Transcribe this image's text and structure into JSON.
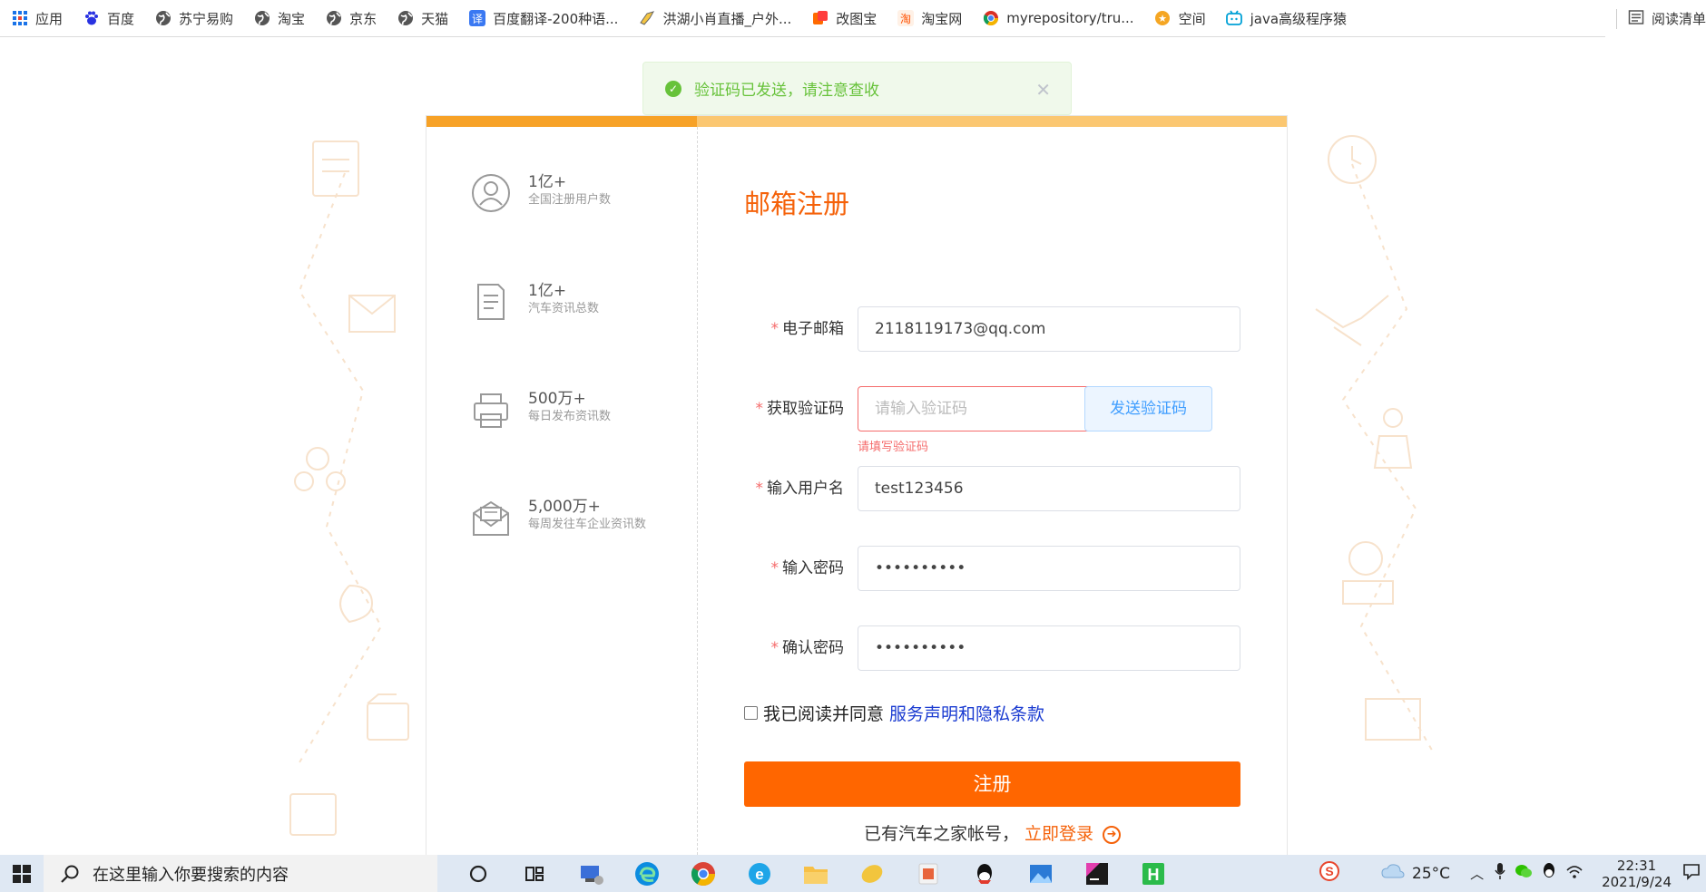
{
  "bookmarks": [
    {
      "label": "应用",
      "icon": "apps-grid-icon",
      "color": "#1a73e8"
    },
    {
      "label": "百度",
      "icon": "baidu-paw-icon",
      "color": "#2932e1"
    },
    {
      "label": "苏宁易购",
      "icon": "globe-icon",
      "color": "#555555"
    },
    {
      "label": "淘宝",
      "icon": "globe-icon",
      "color": "#555555"
    },
    {
      "label": "京东",
      "icon": "globe-icon",
      "color": "#555555"
    },
    {
      "label": "天猫",
      "icon": "globe-icon",
      "color": "#555555"
    },
    {
      "label": "百度翻译-200种语...",
      "icon": "translate-icon",
      "color": "#3a78f2"
    },
    {
      "label": "洪湖小肖直播_户外...",
      "icon": "bird-icon",
      "color": "#666666"
    },
    {
      "label": "改图宝",
      "icon": "gaitubao-icon",
      "color": "#ff6a00"
    },
    {
      "label": "淘宝网",
      "icon": "taobao-icon",
      "color": "#ff5000"
    },
    {
      "label": "myrepository/tru...",
      "icon": "chrome-like-icon",
      "color": "#d93025"
    },
    {
      "label": "空间",
      "icon": "qzone-icon",
      "color": "#f5a623"
    },
    {
      "label": "java高级程序猿",
      "icon": "bilibili-tv-icon",
      "color": "#00a1d6"
    }
  ],
  "reading_list": "阅读清单",
  "toast": {
    "message": "验证码已发送，请注意查收"
  },
  "stats": [
    {
      "num": "1亿+",
      "desc": "全国注册用户数",
      "icon": "user-circle-icon"
    },
    {
      "num": "1亿+",
      "desc": "汽车资讯总数",
      "icon": "document-icon"
    },
    {
      "num": "500万+",
      "desc": "每日发布资讯数",
      "icon": "printer-icon"
    },
    {
      "num": "5,000万+",
      "desc": "每周发往车企业资讯数",
      "icon": "mail-icon"
    }
  ],
  "form": {
    "title": "邮箱注册",
    "required_mark": "*",
    "email_label": "电子邮箱",
    "email_value": "2118119173@qq.com",
    "code_label": "获取验证码",
    "code_placeholder": "请输入验证码",
    "send_code": "发送验证码",
    "code_error": "请填写验证码",
    "username_label": "输入用户名",
    "username_value": "test123456",
    "password_label": "输入密码",
    "password_value": "••••••••••",
    "confirm_label": "确认密码",
    "confirm_value": "••••••••••",
    "agree_text": "我已阅读并同意",
    "agree_link": "服务声明和隐私条款",
    "submit": "注册",
    "login_prompt": "已有汽车之家帐号，",
    "login_link": "立即登录"
  },
  "taskbar": {
    "search_placeholder": "在这里输入你要搜索的内容",
    "temperature": "25°C",
    "time": "22:31",
    "date": "2021/9/24"
  },
  "colors": {
    "accent": "#ff6600",
    "title": "#f5620a",
    "bar_dark": "#f7a227",
    "bar_light": "#fbc771",
    "success": "#67c23a",
    "error": "#f56c6c"
  }
}
